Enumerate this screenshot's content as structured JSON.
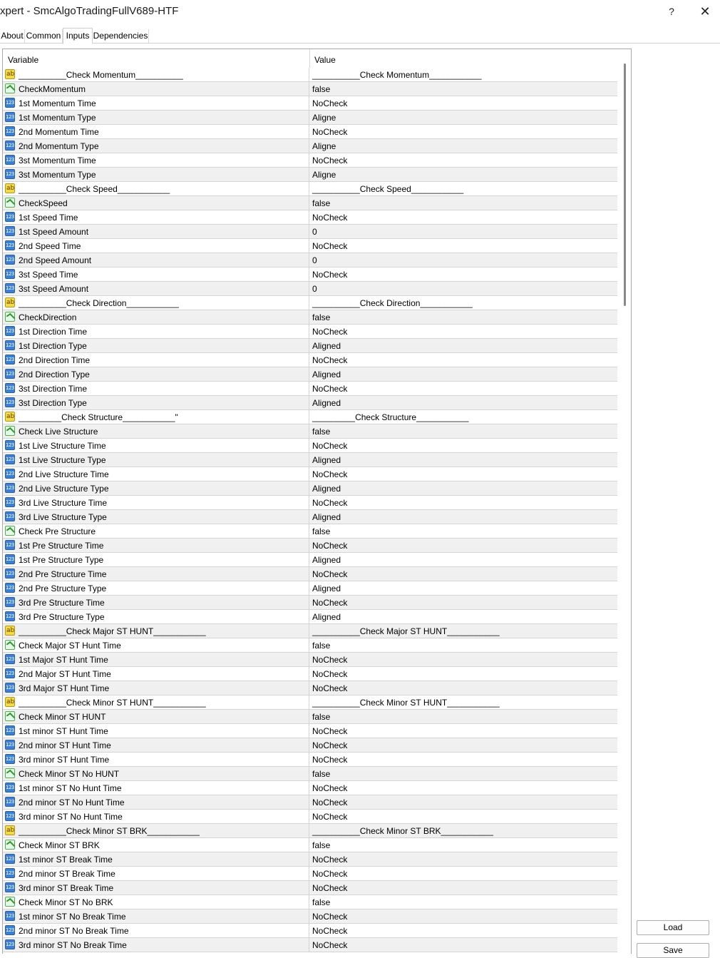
{
  "window": {
    "title": "xpert - SmcAlgoTradingFullV689-HTF",
    "help_label": "?",
    "close_label": "✕"
  },
  "tabs": [
    "About",
    "Common",
    "Inputs",
    "Dependencies"
  ],
  "active_tab": "Inputs",
  "grid": {
    "columns": [
      "Variable",
      "Value"
    ],
    "rows": [
      {
        "icon": "string-icon",
        "variable": "__________Check Momentum__________",
        "value": "__________Check Momentum___________"
      },
      {
        "icon": "bool-icon",
        "variable": "CheckMomentum",
        "value": "false"
      },
      {
        "icon": "number-icon",
        "variable": "1st Momentum Time",
        "value": "NoCheck"
      },
      {
        "icon": "number-icon",
        "variable": "1st Momentum Type",
        "value": "Aligne"
      },
      {
        "icon": "number-icon",
        "variable": "2nd Momentum Time",
        "value": "NoCheck"
      },
      {
        "icon": "number-icon",
        "variable": "2nd Momentum Type",
        "value": "Aligne"
      },
      {
        "icon": "number-icon",
        "variable": "3st Momentum Time",
        "value": "NoCheck"
      },
      {
        "icon": "number-icon",
        "variable": "3st Momentum Type",
        "value": "Aligne"
      },
      {
        "icon": "string-icon",
        "variable": "__________Check Speed___________",
        "value": "__________Check Speed___________"
      },
      {
        "icon": "bool-icon",
        "variable": "CheckSpeed",
        "value": "false"
      },
      {
        "icon": "number-icon",
        "variable": "1st Speed Time",
        "value": "NoCheck"
      },
      {
        "icon": "number-icon",
        "variable": "1st Speed Amount",
        "value": "0"
      },
      {
        "icon": "number-icon",
        "variable": "2nd Speed Time",
        "value": "NoCheck"
      },
      {
        "icon": "number-icon",
        "variable": "2nd Speed Amount",
        "value": "0"
      },
      {
        "icon": "number-icon",
        "variable": "3st Speed Time",
        "value": "NoCheck"
      },
      {
        "icon": "number-icon",
        "variable": "3st Speed Amount",
        "value": "0"
      },
      {
        "icon": "string-icon",
        "variable": "__________Check Direction___________",
        "value": "__________Check Direction___________"
      },
      {
        "icon": "bool-icon",
        "variable": "CheckDirection",
        "value": "false"
      },
      {
        "icon": "number-icon",
        "variable": "1st Direction Time",
        "value": "NoCheck"
      },
      {
        "icon": "number-icon",
        "variable": "1st Direction Type",
        "value": "Aligned"
      },
      {
        "icon": "number-icon",
        "variable": "2nd Direction Time",
        "value": "NoCheck"
      },
      {
        "icon": "number-icon",
        "variable": "2nd Direction Type",
        "value": "Aligned"
      },
      {
        "icon": "number-icon",
        "variable": "3st Direction Time",
        "value": "NoCheck"
      },
      {
        "icon": "number-icon",
        "variable": "3st Direction Type",
        "value": "Aligned"
      },
      {
        "icon": "string-icon",
        "variable": "_________Check Structure___________\"",
        "value": "_________Check Structure___________"
      },
      {
        "icon": "bool-icon",
        "variable": "Check Live Structure",
        "value": "false"
      },
      {
        "icon": "number-icon",
        "variable": "1st Live Structure Time",
        "value": "NoCheck"
      },
      {
        "icon": "number-icon",
        "variable": "1st Live Structure Type",
        "value": "Aligned"
      },
      {
        "icon": "number-icon",
        "variable": "2nd Live Structure Time",
        "value": "NoCheck"
      },
      {
        "icon": "number-icon",
        "variable": "2nd Live Structure Type",
        "value": "Aligned"
      },
      {
        "icon": "number-icon",
        "variable": "3rd Live Structure Time",
        "value": "NoCheck"
      },
      {
        "icon": "number-icon",
        "variable": "3rd Live Structure Type",
        "value": "Aligned"
      },
      {
        "icon": "bool-icon",
        "variable": "Check Pre Structure",
        "value": "false"
      },
      {
        "icon": "number-icon",
        "variable": "1st Pre Structure Time",
        "value": "NoCheck"
      },
      {
        "icon": "number-icon",
        "variable": "1st Pre Structure Type",
        "value": "Aligned"
      },
      {
        "icon": "number-icon",
        "variable": "2nd Pre Structure Time",
        "value": "NoCheck"
      },
      {
        "icon": "number-icon",
        "variable": "2nd Pre Structure Type",
        "value": "Aligned"
      },
      {
        "icon": "number-icon",
        "variable": "3rd Pre Structure Time",
        "value": "NoCheck"
      },
      {
        "icon": "number-icon",
        "variable": "3rd Pre Structure Type",
        "value": "Aligned"
      },
      {
        "icon": "string-icon",
        "variable": "__________Check Major ST HUNT___________",
        "value": "__________Check Major ST HUNT___________"
      },
      {
        "icon": "bool-icon",
        "variable": "Check Major ST Hunt Time",
        "value": "false"
      },
      {
        "icon": "number-icon",
        "variable": "1st Major ST Hunt Time",
        "value": "NoCheck"
      },
      {
        "icon": "number-icon",
        "variable": "2nd Major ST Hunt Time",
        "value": "NoCheck"
      },
      {
        "icon": "number-icon",
        "variable": "3rd Major ST Hunt Time",
        "value": "NoCheck"
      },
      {
        "icon": "string-icon",
        "variable": "__________Check Minor ST HUNT___________",
        "value": "__________Check Minor ST HUNT___________"
      },
      {
        "icon": "bool-icon",
        "variable": "Check Minor ST HUNT",
        "value": "false"
      },
      {
        "icon": "number-icon",
        "variable": "1st minor ST Hunt Time",
        "value": "NoCheck"
      },
      {
        "icon": "number-icon",
        "variable": "2nd minor ST Hunt Time",
        "value": "NoCheck"
      },
      {
        "icon": "number-icon",
        "variable": "3rd minor ST Hunt Time",
        "value": "NoCheck"
      },
      {
        "icon": "bool-icon",
        "variable": "Check Minor ST No HUNT",
        "value": "false"
      },
      {
        "icon": "number-icon",
        "variable": "1st minor ST No Hunt Time",
        "value": "NoCheck"
      },
      {
        "icon": "number-icon",
        "variable": "2nd minor ST No Hunt Time",
        "value": "NoCheck"
      },
      {
        "icon": "number-icon",
        "variable": "3rd minor ST No Hunt Time",
        "value": "NoCheck"
      },
      {
        "icon": "string-icon",
        "variable": "__________Check Minor ST BRK___________",
        "value": "__________Check Minor ST BRK___________"
      },
      {
        "icon": "bool-icon",
        "variable": "Check Minor ST BRK",
        "value": "false"
      },
      {
        "icon": "number-icon",
        "variable": "1st minor ST Break Time",
        "value": "NoCheck"
      },
      {
        "icon": "number-icon",
        "variable": "2nd minor ST Break Time",
        "value": "NoCheck"
      },
      {
        "icon": "number-icon",
        "variable": "3rd minor ST Break Time",
        "value": "NoCheck"
      },
      {
        "icon": "bool-icon",
        "variable": "Check Minor ST No BRK",
        "value": "false"
      },
      {
        "icon": "number-icon",
        "variable": "1st minor ST No Break Time",
        "value": "NoCheck"
      },
      {
        "icon": "number-icon",
        "variable": "2nd minor ST No Break Time",
        "value": "NoCheck"
      },
      {
        "icon": "number-icon",
        "variable": "3rd minor ST No Break Time",
        "value": "NoCheck"
      }
    ]
  },
  "buttons": {
    "load": "Load",
    "save": "Save"
  }
}
